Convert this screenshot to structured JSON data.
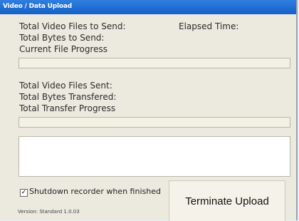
{
  "window": {
    "title": "Video / Data Upload"
  },
  "labels": {
    "total_files_to_send": "Total Video Files to Send:",
    "elapsed_time": "Elapsed Time:",
    "total_bytes_to_send": "Total Bytes to Send:",
    "current_file_progress": "Current File Progress",
    "total_files_sent": "Total Video Files Sent:",
    "total_bytes_transferred": "Total Bytes Transfered:",
    "total_transfer_progress": "Total Transfer Progress"
  },
  "progress": {
    "current_file": 0,
    "total_transfer": 0
  },
  "options": {
    "shutdown_checked": true,
    "shutdown_label": "Shutdown recorder when finished"
  },
  "version": "Version: Standard 1.0.03",
  "buttons": {
    "terminate": "Terminate Upload"
  }
}
